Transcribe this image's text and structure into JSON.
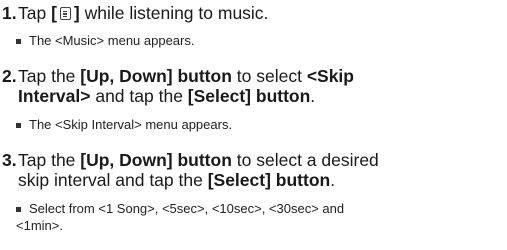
{
  "steps": [
    {
      "number": "1.",
      "text_before_icon": "Tap ",
      "bracket_open": "[",
      "icon": "menu-icon",
      "bracket_close": "]",
      "text_after_icon": " while listening to music.",
      "note": "The <Music> menu appears."
    },
    {
      "number": "2.",
      "line1_prefix": "Tap the ",
      "line1_bold1": "[Up, Down] button",
      "line1_mid": " to select ",
      "line1_bold2": "<Skip",
      "line2_bold": "Interval>",
      "line2_mid": " and tap the ",
      "line2_bold2": "[Select] button",
      "line2_end": ".",
      "note": "The <Skip Interval> menu appears."
    },
    {
      "number": "3.",
      "line1_prefix": "Tap the ",
      "line1_bold": "[Up, Down] button",
      "line1_end": " to select a desired",
      "line2_prefix": "skip interval and tap the ",
      "line2_bold": "[Select] button",
      "line2_end": ".",
      "note_line1": "Select from <1 Song>, <5sec>, <10sec>, <30sec> and",
      "note_line2": "<1min>."
    }
  ]
}
